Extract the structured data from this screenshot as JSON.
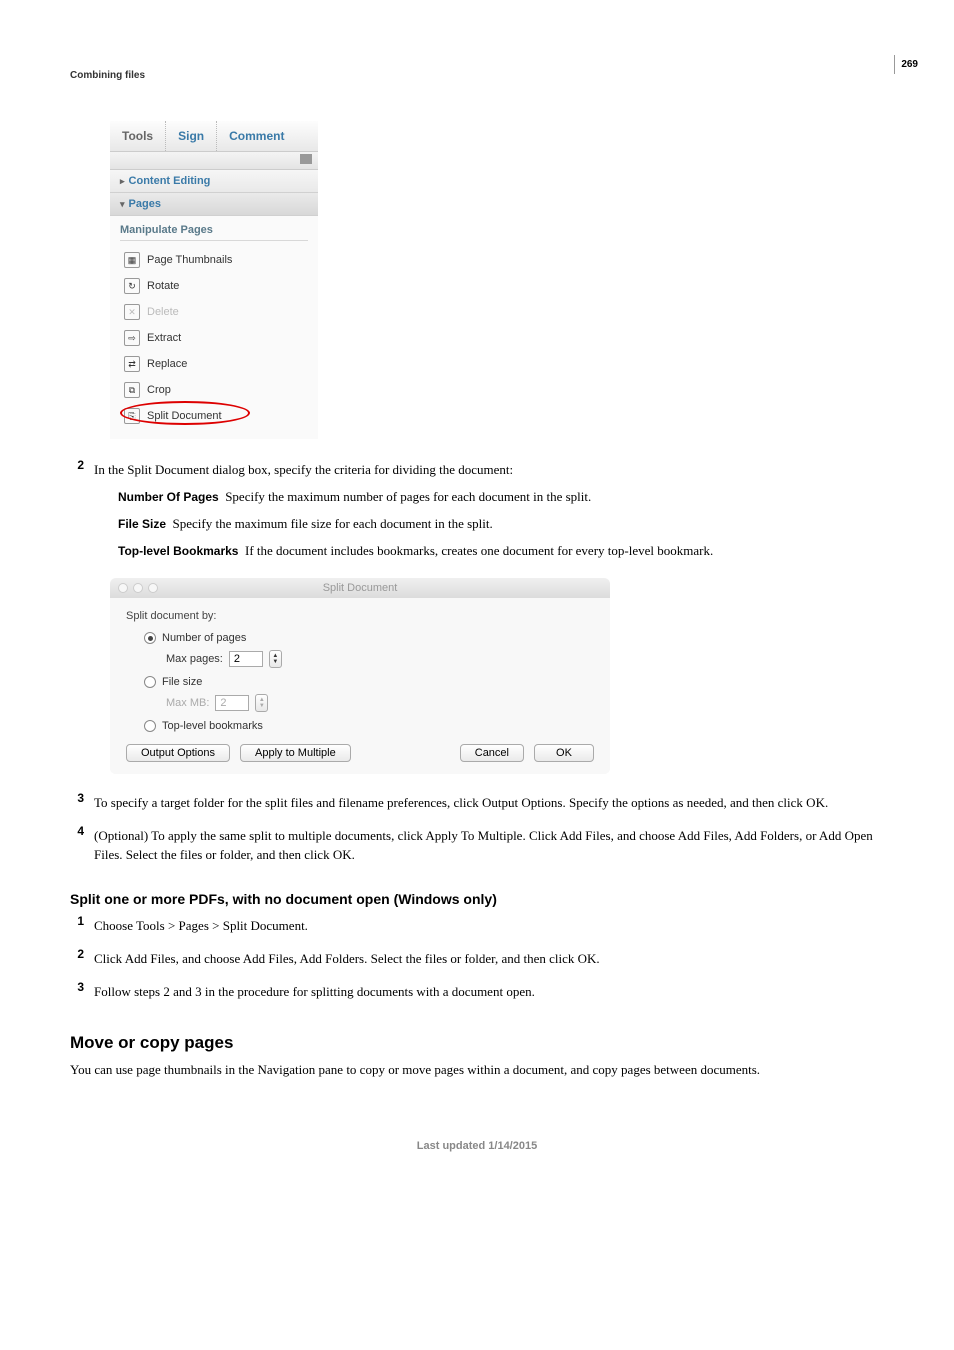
{
  "header": {
    "section_title": "Combining files",
    "page_number": "269"
  },
  "tools_panel": {
    "tabs": {
      "tools": "Tools",
      "sign": "Sign",
      "comment": "Comment"
    },
    "content_editing": "Content Editing",
    "pages": "Pages",
    "manipulate_title": "Manipulate Pages",
    "items": {
      "page_thumbnails": "Page Thumbnails",
      "rotate": "Rotate",
      "delete": "Delete",
      "extract": "Extract",
      "replace": "Replace",
      "crop": "Crop",
      "split_document": "Split Document"
    }
  },
  "steps": {
    "s2": {
      "num": "2",
      "text": "In the Split Document dialog box, specify the criteria for dividing the document:",
      "defs": {
        "num_pages_term": "Number Of Pages",
        "num_pages_text": "Specify the maximum number of pages for each document in the split.",
        "file_size_term": "File Size",
        "file_size_text": "Specify the maximum file size for each document in the split.",
        "bookmarks_term": "Top-level Bookmarks",
        "bookmarks_text": "If the document includes bookmarks, creates one document for every top-level bookmark."
      }
    },
    "s3": {
      "num": "3",
      "text": "To specify a target folder for the split files and filename preferences, click Output Options. Specify the options as needed, and then click OK."
    },
    "s4": {
      "num": "4",
      "text": "(Optional) To apply the same split to multiple documents, click Apply To Multiple. Click Add Files, and choose Add Files, Add Folders, or Add Open Files. Select the files or folder, and then click OK."
    }
  },
  "dialog": {
    "title": "Split Document",
    "split_by": "Split document by:",
    "opt_num_pages": "Number of pages",
    "max_pages_label": "Max pages:",
    "max_pages_value": "2",
    "opt_file_size": "File size",
    "max_mb_label": "Max MB:",
    "max_mb_value": "2",
    "opt_bookmarks": "Top-level bookmarks",
    "buttons": {
      "output_options": "Output Options",
      "apply_multiple": "Apply to Multiple",
      "cancel": "Cancel",
      "ok": "OK"
    }
  },
  "section_split_no_doc": {
    "heading": "Split one or more PDFs, with no document open (Windows only)",
    "s1": {
      "num": "1",
      "text": "Choose Tools > Pages > Split Document."
    },
    "s2": {
      "num": "2",
      "text": "Click Add Files, and choose Add Files, Add Folders. Select the files or folder, and then click OK."
    },
    "s3": {
      "num": "3",
      "text": "Follow steps 2 and 3 in the procedure for splitting documents with a document open."
    }
  },
  "section_move": {
    "heading": "Move or copy pages",
    "para": "You can use page thumbnails in the Navigation pane to copy or move pages within a document, and copy pages between documents."
  },
  "footer": "Last updated 1/14/2015"
}
